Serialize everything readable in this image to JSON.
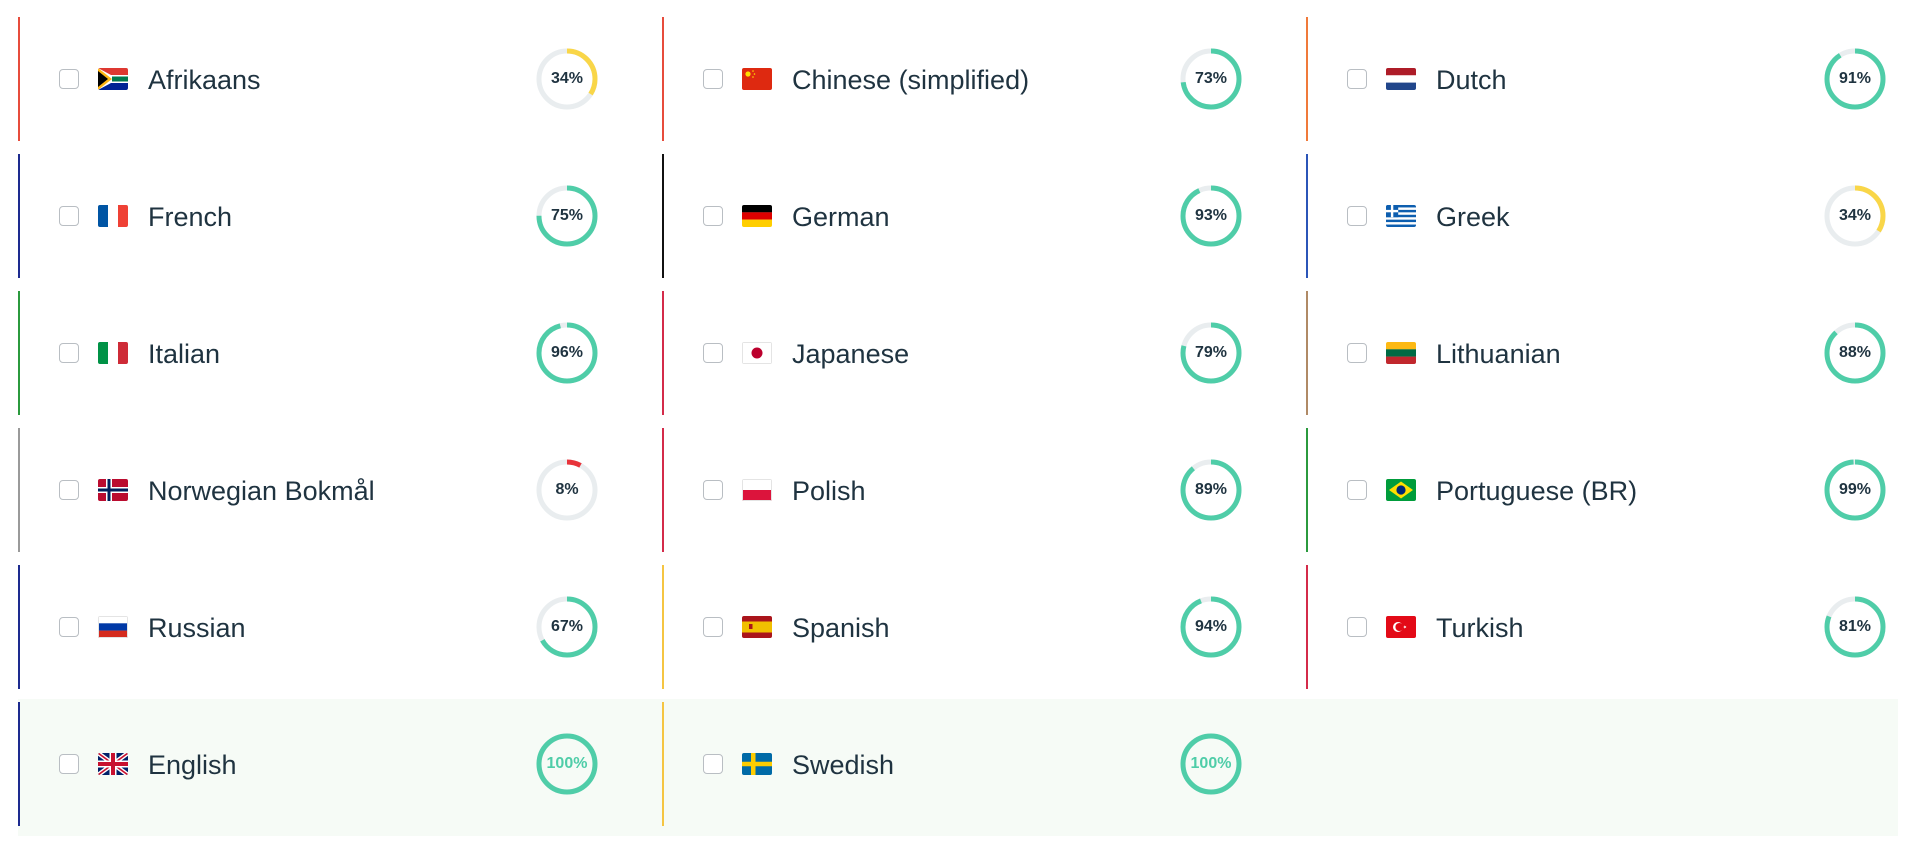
{
  "colors": {
    "complete": "#4fcda8",
    "partial_low": "#f9d648",
    "partial_very_low": "#e8333a",
    "ring_track": "#e9edef",
    "text": "#1f3340"
  },
  "languages": [
    {
      "name": "Afrikaans",
      "percent": 34,
      "percent_label": "34%",
      "flag": "south-africa-flag-icon",
      "accent": "#e74c3c"
    },
    {
      "name": "Chinese (simplified)",
      "percent": 73,
      "percent_label": "73%",
      "flag": "china-flag-icon",
      "accent": "#e74c3c"
    },
    {
      "name": "Dutch",
      "percent": 91,
      "percent_label": "91%",
      "flag": "netherlands-flag-icon",
      "accent": "#f07a3a"
    },
    {
      "name": "French",
      "percent": 75,
      "percent_label": "75%",
      "flag": "france-flag-icon",
      "accent": "#1d2b8f"
    },
    {
      "name": "German",
      "percent": 93,
      "percent_label": "93%",
      "flag": "germany-flag-icon",
      "accent": "#111111"
    },
    {
      "name": "Greek",
      "percent": 34,
      "percent_label": "34%",
      "flag": "greece-flag-icon",
      "accent": "#2b55b8"
    },
    {
      "name": "Italian",
      "percent": 96,
      "percent_label": "96%",
      "flag": "italy-flag-icon",
      "accent": "#2b9a3e"
    },
    {
      "name": "Japanese",
      "percent": 79,
      "percent_label": "79%",
      "flag": "japan-flag-icon",
      "accent": "#d42b4a"
    },
    {
      "name": "Lithuanian",
      "percent": 88,
      "percent_label": "88%",
      "flag": "lithuania-flag-icon",
      "accent": "#b08a66"
    },
    {
      "name": "Norwegian Bokmål",
      "percent": 8,
      "percent_label": "8%",
      "flag": "norway-flag-icon",
      "accent": "#9a9a9a"
    },
    {
      "name": "Polish",
      "percent": 89,
      "percent_label": "89%",
      "flag": "poland-flag-icon",
      "accent": "#d42b4a"
    },
    {
      "name": "Portuguese (BR)",
      "percent": 99,
      "percent_label": "99%",
      "flag": "brazil-flag-icon",
      "accent": "#2b9a3e"
    },
    {
      "name": "Russian",
      "percent": 67,
      "percent_label": "67%",
      "flag": "russia-flag-icon",
      "accent": "#1d2b8f"
    },
    {
      "name": "Spanish",
      "percent": 94,
      "percent_label": "94%",
      "flag": "spain-flag-icon",
      "accent": "#f5c542"
    },
    {
      "name": "Turkish",
      "percent": 81,
      "percent_label": "81%",
      "flag": "turkey-flag-icon",
      "accent": "#d42b4a"
    },
    {
      "name": "English",
      "percent": 100,
      "percent_label": "100%",
      "flag": "united-kingdom-flag-icon",
      "accent": "#1d2b8f"
    },
    {
      "name": "Swedish",
      "percent": 100,
      "percent_label": "100%",
      "flag": "sweden-flag-icon",
      "accent": "#f5c542"
    }
  ]
}
